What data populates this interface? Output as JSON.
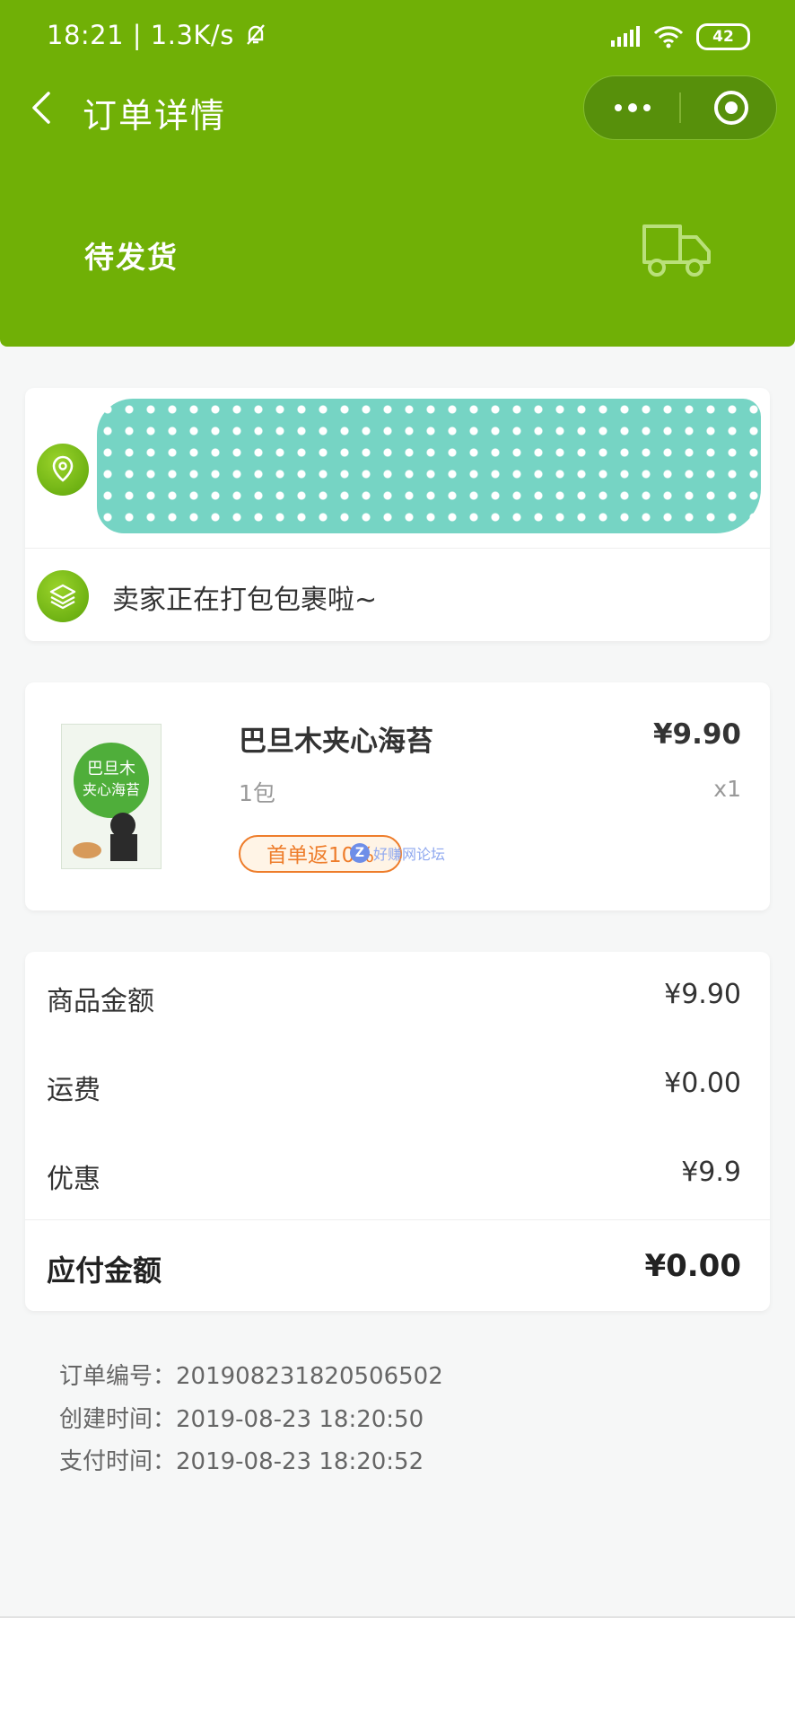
{
  "status_bar": {
    "time": "18:21",
    "speed": "1.3K/s",
    "battery": "42"
  },
  "nav": {
    "title": "订单详情"
  },
  "order": {
    "status": "待发货"
  },
  "shipping": {
    "message": "卖家正在打包包裹啦~"
  },
  "product": {
    "name": "巴旦木夹心海苔",
    "price": "¥9.90",
    "spec": "1包",
    "qty": "x1",
    "badge": "首单返10%",
    "watermark": "好赚网论坛"
  },
  "summary": {
    "goods_label": "商品金额",
    "goods_value": "¥9.90",
    "freight_label": "运费",
    "freight_value": "¥0.00",
    "discount_label": "优惠",
    "discount_value": "¥9.9",
    "total_label": "应付金额",
    "total_value": "¥0.00"
  },
  "info": {
    "order_no": "订单编号：2019082318205065О2",
    "created": "创建时间：2019-08-23 18:20:50",
    "paid": "支付时间：2019-08-23 18:20:52"
  },
  "colors": {
    "brand": "#70b006",
    "badge": "#ee7d2b",
    "blur": "#76d4c4"
  }
}
